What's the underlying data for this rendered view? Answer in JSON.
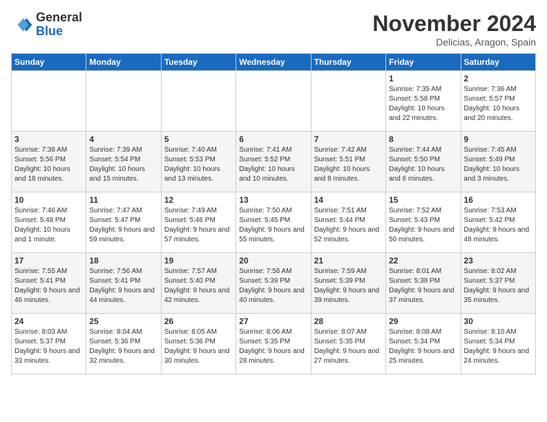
{
  "logo": {
    "line1": "General",
    "line2": "Blue"
  },
  "title": "November 2024",
  "subtitle": "Delicias, Aragon, Spain",
  "days_of_week": [
    "Sunday",
    "Monday",
    "Tuesday",
    "Wednesday",
    "Thursday",
    "Friday",
    "Saturday"
  ],
  "weeks": [
    [
      {
        "num": "",
        "info": ""
      },
      {
        "num": "",
        "info": ""
      },
      {
        "num": "",
        "info": ""
      },
      {
        "num": "",
        "info": ""
      },
      {
        "num": "",
        "info": ""
      },
      {
        "num": "1",
        "info": "Sunrise: 7:35 AM\nSunset: 5:58 PM\nDaylight: 10 hours and 22 minutes."
      },
      {
        "num": "2",
        "info": "Sunrise: 7:36 AM\nSunset: 5:57 PM\nDaylight: 10 hours and 20 minutes."
      }
    ],
    [
      {
        "num": "3",
        "info": "Sunrise: 7:38 AM\nSunset: 5:56 PM\nDaylight: 10 hours and 18 minutes."
      },
      {
        "num": "4",
        "info": "Sunrise: 7:39 AM\nSunset: 5:54 PM\nDaylight: 10 hours and 15 minutes."
      },
      {
        "num": "5",
        "info": "Sunrise: 7:40 AM\nSunset: 5:53 PM\nDaylight: 10 hours and 13 minutes."
      },
      {
        "num": "6",
        "info": "Sunrise: 7:41 AM\nSunset: 5:52 PM\nDaylight: 10 hours and 10 minutes."
      },
      {
        "num": "7",
        "info": "Sunrise: 7:42 AM\nSunset: 5:51 PM\nDaylight: 10 hours and 8 minutes."
      },
      {
        "num": "8",
        "info": "Sunrise: 7:44 AM\nSunset: 5:50 PM\nDaylight: 10 hours and 6 minutes."
      },
      {
        "num": "9",
        "info": "Sunrise: 7:45 AM\nSunset: 5:49 PM\nDaylight: 10 hours and 3 minutes."
      }
    ],
    [
      {
        "num": "10",
        "info": "Sunrise: 7:46 AM\nSunset: 5:48 PM\nDaylight: 10 hours and 1 minute."
      },
      {
        "num": "11",
        "info": "Sunrise: 7:47 AM\nSunset: 5:47 PM\nDaylight: 9 hours and 59 minutes."
      },
      {
        "num": "12",
        "info": "Sunrise: 7:49 AM\nSunset: 5:46 PM\nDaylight: 9 hours and 57 minutes."
      },
      {
        "num": "13",
        "info": "Sunrise: 7:50 AM\nSunset: 5:45 PM\nDaylight: 9 hours and 55 minutes."
      },
      {
        "num": "14",
        "info": "Sunrise: 7:51 AM\nSunset: 5:44 PM\nDaylight: 9 hours and 52 minutes."
      },
      {
        "num": "15",
        "info": "Sunrise: 7:52 AM\nSunset: 5:43 PM\nDaylight: 9 hours and 50 minutes."
      },
      {
        "num": "16",
        "info": "Sunrise: 7:53 AM\nSunset: 5:42 PM\nDaylight: 9 hours and 48 minutes."
      }
    ],
    [
      {
        "num": "17",
        "info": "Sunrise: 7:55 AM\nSunset: 5:41 PM\nDaylight: 9 hours and 46 minutes."
      },
      {
        "num": "18",
        "info": "Sunrise: 7:56 AM\nSunset: 5:41 PM\nDaylight: 9 hours and 44 minutes."
      },
      {
        "num": "19",
        "info": "Sunrise: 7:57 AM\nSunset: 5:40 PM\nDaylight: 9 hours and 42 minutes."
      },
      {
        "num": "20",
        "info": "Sunrise: 7:58 AM\nSunset: 5:39 PM\nDaylight: 9 hours and 40 minutes."
      },
      {
        "num": "21",
        "info": "Sunrise: 7:59 AM\nSunset: 5:39 PM\nDaylight: 9 hours and 39 minutes."
      },
      {
        "num": "22",
        "info": "Sunrise: 8:01 AM\nSunset: 5:38 PM\nDaylight: 9 hours and 37 minutes."
      },
      {
        "num": "23",
        "info": "Sunrise: 8:02 AM\nSunset: 5:37 PM\nDaylight: 9 hours and 35 minutes."
      }
    ],
    [
      {
        "num": "24",
        "info": "Sunrise: 8:03 AM\nSunset: 5:37 PM\nDaylight: 9 hours and 33 minutes."
      },
      {
        "num": "25",
        "info": "Sunrise: 8:04 AM\nSunset: 5:36 PM\nDaylight: 9 hours and 32 minutes."
      },
      {
        "num": "26",
        "info": "Sunrise: 8:05 AM\nSunset: 5:36 PM\nDaylight: 9 hours and 30 minutes."
      },
      {
        "num": "27",
        "info": "Sunrise: 8:06 AM\nSunset: 5:35 PM\nDaylight: 9 hours and 28 minutes."
      },
      {
        "num": "28",
        "info": "Sunrise: 8:07 AM\nSunset: 5:35 PM\nDaylight: 9 hours and 27 minutes."
      },
      {
        "num": "29",
        "info": "Sunrise: 8:08 AM\nSunset: 5:34 PM\nDaylight: 9 hours and 25 minutes."
      },
      {
        "num": "30",
        "info": "Sunrise: 8:10 AM\nSunset: 5:34 PM\nDaylight: 9 hours and 24 minutes."
      }
    ]
  ]
}
